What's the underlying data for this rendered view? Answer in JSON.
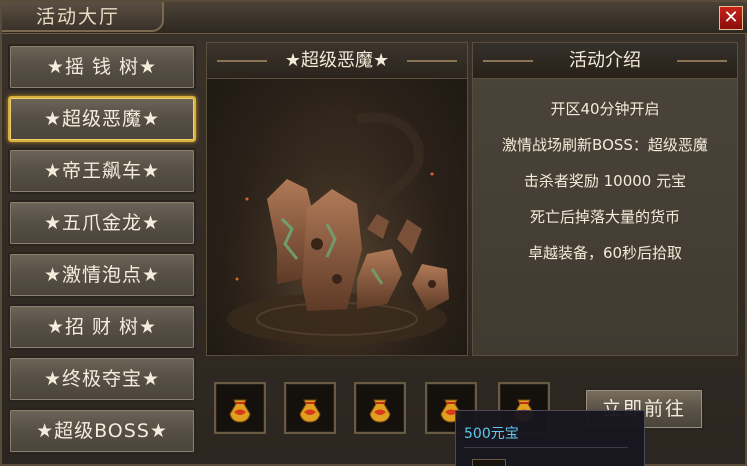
{
  "window": {
    "title": "活动大厅",
    "close_glyph": "✕"
  },
  "menu": {
    "items": [
      {
        "label": "★摇 钱 树★",
        "selected": false
      },
      {
        "label": "★超级恶魔★",
        "selected": true
      },
      {
        "label": "★帝王飙车★",
        "selected": false
      },
      {
        "label": "★五爪金龙★",
        "selected": false
      },
      {
        "label": "★激情泡点★",
        "selected": false
      },
      {
        "label": "★招 财 树★",
        "selected": false
      },
      {
        "label": "★终极夺宝★",
        "selected": false
      },
      {
        "label": "★超级BOSS★",
        "selected": false
      }
    ]
  },
  "boss_panel": {
    "title": "★超级恶魔★"
  },
  "info_panel": {
    "title": "活动介绍",
    "lines": [
      "开区40分钟开启",
      "激情战场刷新BOSS：超级恶魔",
      "击杀者奖励 10000 元宝",
      "死亡后掉落大量的货币",
      "卓越装备，60秒后拾取"
    ]
  },
  "rewards": {
    "slot_count": 5,
    "icon": "yuanbao-pouch-icon"
  },
  "go_button": {
    "label": "立即前往"
  },
  "tooltip": {
    "name": "500元宝"
  },
  "colors": {
    "accent_gold": "#d8b040",
    "tooltip_name": "#5ec8f0",
    "close_red": "#c8221a"
  }
}
